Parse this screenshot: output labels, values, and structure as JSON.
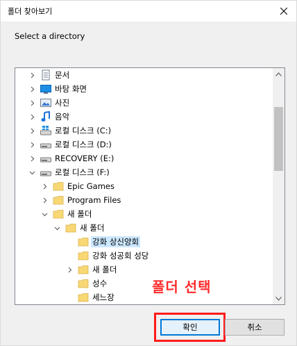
{
  "window": {
    "title": "폴더 찾아보기",
    "close_glyph": "✕"
  },
  "prompt": "Select a directory",
  "tree": {
    "items": [
      {
        "label": "문서",
        "icon": "documents-icon",
        "expander": "collapsed",
        "depth": 0
      },
      {
        "label": "바탕 화면",
        "icon": "desktop-icon",
        "expander": "collapsed",
        "depth": 0
      },
      {
        "label": "사진",
        "icon": "pictures-icon",
        "expander": "collapsed",
        "depth": 0
      },
      {
        "label": "음악",
        "icon": "music-icon",
        "expander": "collapsed",
        "depth": 0
      },
      {
        "label": "로컬 디스크 (C:)",
        "icon": "windows-drive-icon",
        "expander": "collapsed",
        "depth": 0
      },
      {
        "label": "로컬 디스크 (D:)",
        "icon": "drive-icon",
        "expander": "collapsed",
        "depth": 0
      },
      {
        "label": "RECOVERY (E:)",
        "icon": "drive-icon",
        "expander": "collapsed",
        "depth": 0
      },
      {
        "label": "로컬 디스크 (F:)",
        "icon": "drive-icon",
        "expander": "expanded",
        "depth": 0
      },
      {
        "label": "Epic Games",
        "icon": "folder-icon",
        "expander": "collapsed",
        "depth": 1
      },
      {
        "label": "Program Files",
        "icon": "folder-icon",
        "expander": "collapsed",
        "depth": 1
      },
      {
        "label": "새 폴더",
        "icon": "folder-icon",
        "expander": "expanded",
        "depth": 1
      },
      {
        "label": "새 폴더",
        "icon": "folder-icon",
        "expander": "expanded",
        "depth": 2
      },
      {
        "label": "강화 상신양회",
        "icon": "folder-icon",
        "expander": "none",
        "depth": 3,
        "selected": true
      },
      {
        "label": "강화 성공회 성당",
        "icon": "folder-icon",
        "expander": "none",
        "depth": 3
      },
      {
        "label": "새 폴더",
        "icon": "folder-icon",
        "expander": "collapsed",
        "depth": 3
      },
      {
        "label": "성수",
        "icon": "folder-icon",
        "expander": "none",
        "depth": 3
      },
      {
        "label": "세느장",
        "icon": "folder-icon",
        "expander": "none",
        "depth": 3
      }
    ]
  },
  "annotation": "폴더 선택",
  "buttons": {
    "ok": "확인",
    "cancel": "취소"
  },
  "colors": {
    "selection": "#cce8ff",
    "folder": "#f8d775",
    "accent": "#0078d7",
    "annotation": "#ff2a2a"
  }
}
